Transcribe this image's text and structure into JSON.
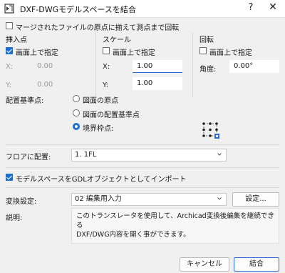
{
  "window": {
    "title": "DXF-DWGモデルスペースを結合",
    "help_label": "?",
    "close_label": "✕"
  },
  "match_origin": {
    "label": "マージされたファイルの原点に揃えて測点まで回転",
    "checked": false
  },
  "insertion_point": {
    "header": "挿入点",
    "onscreen_label": "画面上で指定",
    "onscreen_checked": true,
    "x_label": "X:",
    "x_value": "0.00",
    "y_label": "Y:",
    "y_value": "0.00"
  },
  "scale": {
    "header": "スケール",
    "onscreen_label": "画面上で指定",
    "onscreen_checked": false,
    "x_label": "X:",
    "x_value": "1.00",
    "y_label": "Y:",
    "y_value": "1.00"
  },
  "rotation": {
    "header": "回転",
    "onscreen_label": "画面上で指定",
    "onscreen_checked": false,
    "angle_label": "角度:",
    "angle_value": "0.00°"
  },
  "anchor": {
    "label": "配置基準点:",
    "options": [
      {
        "label": "図面の原点",
        "selected": false
      },
      {
        "label": "図面の配置基準点",
        "selected": false
      },
      {
        "label": "境界枠点:",
        "selected": true
      }
    ]
  },
  "floor": {
    "label": "フロアに配置:",
    "value": "1. 1FL"
  },
  "gdl_import": {
    "label": "モデルスペースをGDLオブジェクトとしてインポート",
    "checked": true
  },
  "translator": {
    "label": "変換設定:",
    "value": "02 編集用入力",
    "settings_button": "設定..."
  },
  "description": {
    "label": "説明:",
    "line1": "このトランスレータを使用して、Archicad変換後編集を継続できる",
    "line2": "DXF/DWG内容を開く事ができます。"
  },
  "footer": {
    "cancel_label": "キャンセル",
    "ok_label": "結合"
  },
  "colors": {
    "accent": "#1f6fd0",
    "background": "#f0f0f0"
  }
}
